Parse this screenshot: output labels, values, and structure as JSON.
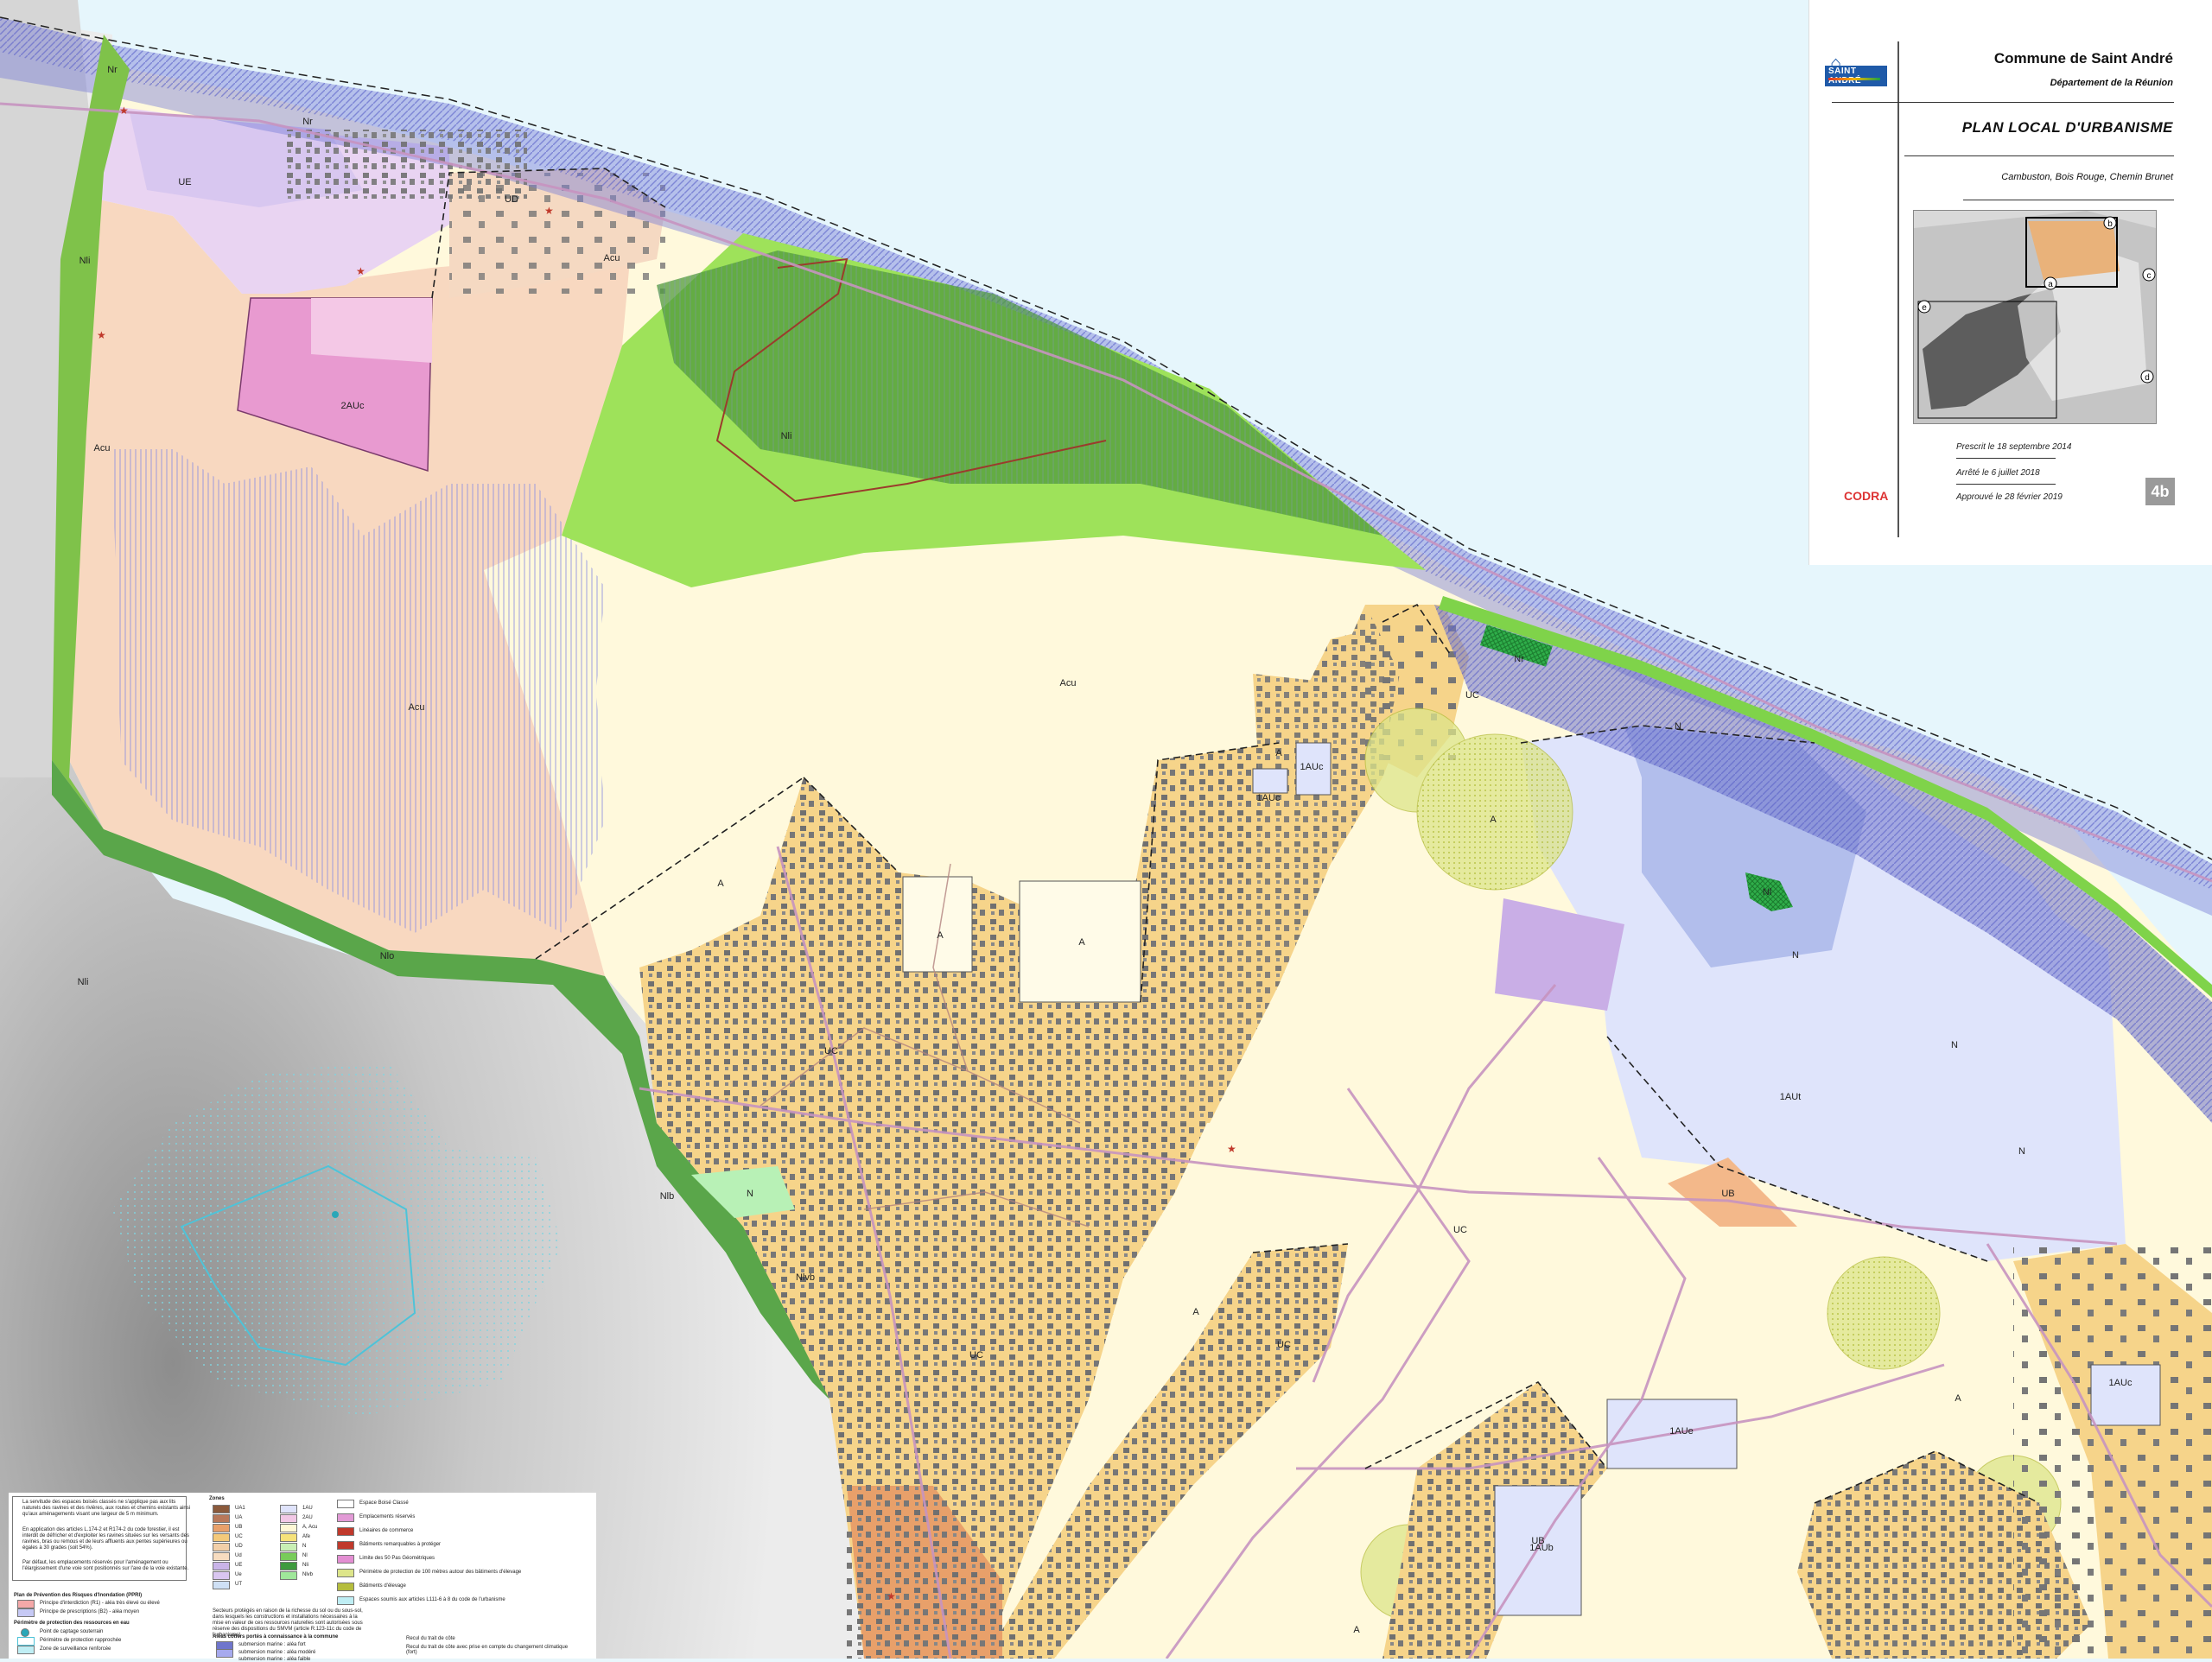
{
  "title_block": {
    "logo_text": "SAINT ANDRÉ",
    "commune": "Commune de Saint André",
    "department": "Département de la Réunion",
    "plan_title": "PLAN LOCAL D'URBANISME",
    "areas": "Cambuston, Bois Rouge, Chemin Brunet",
    "minimap_labels": [
      "a",
      "b",
      "c",
      "d",
      "e"
    ],
    "dates": [
      "Prescrit le 18 septembre 2014",
      "Arrêté le 6 juillet 2018",
      "Approuvé le 28 février 2019"
    ],
    "firm": "CODRA",
    "sheet_number": "4b"
  },
  "zone_labels": {
    "ue": "UE",
    "ud": "UD",
    "acu_top": "Acu",
    "auc2": "2AUc",
    "acu_west": "Acu",
    "nli": "Nli",
    "acu_center": "Acu",
    "acu_mid": "Acu",
    "a1": "A",
    "a2": "A",
    "a3": "A",
    "a4": "A",
    "uc1": "UC",
    "uc2": "UC",
    "uc3": "UC",
    "uc4": "UC",
    "ue_coast": "UC",
    "auc1": "1AUc",
    "auc1b": "1AUc",
    "aut": "1AUt",
    "aue": "1AUe",
    "aub": "1AUb",
    "ub1": "UB",
    "ub2": "UB",
    "a5": "A",
    "a6": "A",
    "a7": "A",
    "a8": "A",
    "nr1": "Nr",
    "nr2": "Nr",
    "nr3": "Nr",
    "n1": "N",
    "n2": "N",
    "n3": "N",
    "n4": "N",
    "nlo": "Nlo",
    "nl1": "Nli",
    "n5": "N",
    "nlb": "Nlb",
    "nlvb": "Nlvb",
    "ni": "Nl",
    "nli2": "Nli",
    "aulc": "1AUc"
  },
  "legend": {
    "notes": [
      "La servitude des espaces boisés classés ne s'applique pas aux lits naturels des ravines et des rivières, aux routes et chemins existants ainsi qu'aux aménagements visant une largeur de 5 m minimum.",
      "En application des articles L.174-2 et R174-2 du code forestier, il est interdit de défricher et d'exploiter les ravines situées sur les versants des ravines, bras ou remous et de leurs affluents aux pentes supérieures ou égales à 30 grades (soit 54%).",
      "Par défaut, les emplacements réservés pour l'aménagement ou l'élargissement d'une voie sont positionnés sur l'axe de la voie existante."
    ],
    "ppri_title": "Plan de Prévention des Risques d'Inondation (PPRI)",
    "ppri_items": [
      "Principe d'interdiction (R1) - aléa très élevé ou élevé",
      "Principe de prescriptions (B2) - aléa moyen"
    ],
    "water_title": "Périmètre de protection des ressources en eau",
    "water_items": [
      "Point de captage souterrain",
      "Périmètre de protection rapprochée",
      "Zone de surveillance renforcée"
    ],
    "zones_title": "Zones",
    "zones": [
      {
        "code": "UA1",
        "color": "#8b5a3c"
      },
      {
        "code": "UA",
        "color": "#b8785a"
      },
      {
        "code": "UB",
        "color": "#e8a06a"
      },
      {
        "code": "UC",
        "color": "#f4c97a"
      },
      {
        "code": "UD",
        "color": "#f2cfa8"
      },
      {
        "code": "Ud",
        "color": "#f7dcc0"
      },
      {
        "code": "UE",
        "color": "#c9b4e8"
      },
      {
        "code": "Ue",
        "color": "#d9c6f0"
      },
      {
        "code": "UT",
        "color": "#cfe0f5"
      },
      {
        "code": "1AU",
        "color": "#dfe3fb"
      },
      {
        "code": "2AU",
        "color": "#f2c8e6"
      },
      {
        "code": "A, Acu",
        "color": "#fff8d6"
      },
      {
        "code": "Afe",
        "color": "#f6e27a"
      },
      {
        "code": "N",
        "color": "#c9f0b5"
      },
      {
        "code": "Nl",
        "color": "#78cc5a"
      },
      {
        "code": "Nli",
        "color": "#3e9a3e"
      },
      {
        "code": "Nlvb",
        "color": "#9fe79a"
      }
    ],
    "items": [
      "Espace Boisé Classé",
      "Emplacements réservés",
      "Linéaires de commerce",
      "Bâtiments remarquables à protéger",
      "Limite des 50 Pas Géométriques",
      "Périmètre de protection de 100 mètres autour des bâtiments d'élevage",
      "Bâtiments d'élevage",
      "Espaces soumis aux articles L111-6 à 8 du code de l'urbanisme"
    ],
    "coastal_title": "Aléas côtiers portés à connaissance à la commune",
    "coastal_items": [
      "submersion marine : aléa fort",
      "submersion marine : aléa modéré",
      "submersion marine : aléa faible"
    ],
    "setback_items": [
      "Recul du trait de côte",
      "Recul du trait de côte avec prise en compte du changement climatique (fort)"
    ],
    "sensitive_note": "Secteurs protégés en raison de la richesse du sol ou du sous-sol, dans lesquels les constructions et installations nécessaires à la mise en valeur de ces ressources naturelles sont autorisées sous réserve des dispositions du SMVM (article R.123-11c du code de l'urbanisme)"
  },
  "colors": {
    "sea": "#e6f6fc",
    "acu_agri": "#fff9dc",
    "acu_urban_edge": "#f8d8c0",
    "uc_residential": "#f6d48a",
    "ue": "#cbb7ef",
    "auc2": "#e89ad0",
    "natural_green": "#9ee25a",
    "natural_dark": "#4f9a3c",
    "coastal_band": "#7b7fd8",
    "aut": "#dfe4fb",
    "buildings": "#6f6f6f",
    "roads": "#c794c0"
  }
}
